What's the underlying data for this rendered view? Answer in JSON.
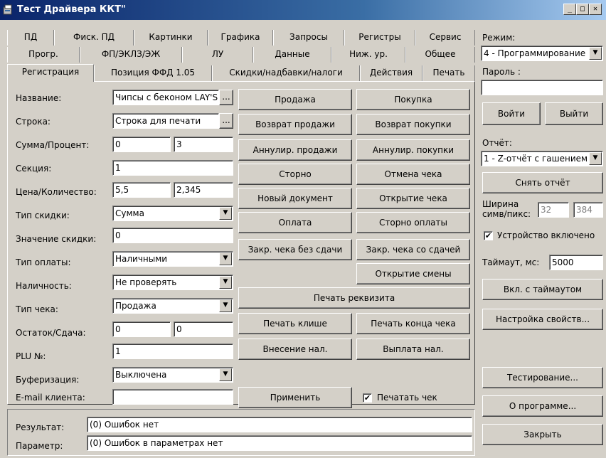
{
  "window": {
    "title": "Тест Драйвера ККТ\""
  },
  "tabs": {
    "row1": [
      "ПД",
      "Фиск. ПД",
      "Картинки",
      "Графика",
      "Запросы",
      "Регистры",
      "Сервис"
    ],
    "row2": [
      "Прогр.",
      "ФП/ЭКЛЗ/ЭЖ",
      "ЛУ",
      "Данные",
      "Ниж. ур.",
      "Общее"
    ],
    "row3": [
      "Регистрация",
      "Позиция ФФД 1.05",
      "Скидки/надбавки/налоги",
      "Действия",
      "Печать"
    ],
    "active": "Регистрация"
  },
  "form": {
    "name_label": "Название:",
    "name_value": "Чипсы с беконом LAY'S",
    "name_btn": "...",
    "line_label": "Строка:",
    "line_value": "Строка для печати",
    "line_btn": "...",
    "sum_label": "Сумма/Процент:",
    "sum_value": "0",
    "percent_value": "3",
    "section_label": "Секция:",
    "section_value": "1",
    "price_label": "Цена/Количество:",
    "price_value": "5,5",
    "qty_value": "2,345",
    "disc_type_label": "Тип скидки:",
    "disc_type_value": "Сумма",
    "disc_value_label": "Значение скидки:",
    "disc_value_value": "0",
    "pay_type_label": "Тип оплаты:",
    "pay_type_value": "Наличными",
    "cash_label": "Наличность:",
    "cash_value": "Не проверять",
    "check_type_label": "Тип чека:",
    "check_type_value": "Продажа",
    "rest_label": "Остаток/Сдача:",
    "rest_value": "0",
    "change_value": "0",
    "plu_label": "PLU №:",
    "plu_value": "1",
    "buffer_label": "Буферизация:",
    "buffer_value": "Выключена",
    "email_label": "E-mail клиента:",
    "email_value": ""
  },
  "actions": {
    "sale": "Продажа",
    "purchase": "Покупка",
    "return_sale": "Возврат продажи",
    "return_purchase": "Возврат покупки",
    "annul_sale": "Аннулир. продажи",
    "annul_purchase": "Аннулир. покупки",
    "storno": "Сторно",
    "cancel_check": "Отмена чека",
    "new_doc": "Новый документ",
    "open_check": "Открытие чека",
    "payment": "Оплата",
    "storno_payment": "Сторно оплаты",
    "close_no_change": "Закр. чека без сдачи",
    "close_with_change": "Закр. чека со сдачей",
    "open_shift": "Открытие смены",
    "print_requisite": "Печать реквизита",
    "print_cliche": "Печать клише",
    "print_check_end": "Печать конца чека",
    "cash_in": "Внесение нал.",
    "cash_out": "Выплата нал.",
    "apply": "Применить",
    "print_check_label": "Печатать чек",
    "print_check_checked": true
  },
  "result": {
    "result_label": "Результат:",
    "result_value": "(0) Ошибок нет",
    "param_label": "Параметр:",
    "param_value": "(0) Ошибок в параметрах нет"
  },
  "right": {
    "mode_label": "Режим:",
    "mode_value": "4 - Программирование",
    "password_label": "Пароль :",
    "password_value": "",
    "login": "Войти",
    "logout": "Выйти",
    "report_label": "Отчёт:",
    "report_value": "1 - Z-отчёт с гашением",
    "take_report": "Снять отчёт",
    "width_label_1": "Ширина",
    "width_label_2": "симв/пикс:",
    "width_chars": "32",
    "width_pixels": "384",
    "device_on_label": "Устройство включено",
    "device_on_checked": true,
    "timeout_label": "Таймаут, мс:",
    "timeout_value": "5000",
    "on_timeout": "Вкл. с таймаутом",
    "settings": "Настройка свойств...",
    "testing": "Тестирование...",
    "about": "О программе...",
    "close": "Закрыть"
  }
}
